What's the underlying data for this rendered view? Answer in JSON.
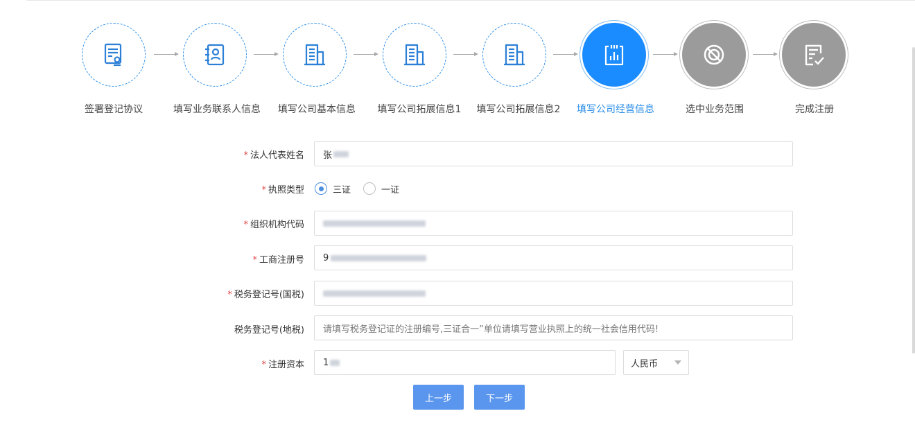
{
  "steps": [
    {
      "label": "签署登记协议",
      "icon": "sign-agreement-icon",
      "state": "done"
    },
    {
      "label": "填写业务联系人信息",
      "icon": "contacts-icon",
      "state": "done"
    },
    {
      "label": "填写公司基本信息",
      "icon": "building-icon",
      "state": "done"
    },
    {
      "label": "填写公司拓展信息1",
      "icon": "building-icon",
      "state": "done"
    },
    {
      "label": "填写公司拓展信息2",
      "icon": "building-icon",
      "state": "done"
    },
    {
      "label": "填写公司经营信息",
      "icon": "chart-board-icon",
      "state": "active"
    },
    {
      "label": "选中业务范围",
      "icon": "no-scope-icon",
      "state": "todo"
    },
    {
      "label": "完成注册",
      "icon": "checklist-icon",
      "state": "todo"
    }
  ],
  "colors": {
    "accent": "#1a8cff",
    "required": "#e14d4d",
    "button": "#5b96ee",
    "inactive": "#9b9b9b"
  },
  "form": {
    "legal_rep": {
      "label": "法人代表姓名",
      "value": "张"
    },
    "license_type": {
      "label": "执照类型",
      "options": [
        "三证",
        "一证"
      ],
      "selected": "三证"
    },
    "org_code": {
      "label": "组织机构代码"
    },
    "business_reg": {
      "label": "工商注册号",
      "value_prefix": "9"
    },
    "tax_national": {
      "label": "税务登记号(国税)"
    },
    "tax_local": {
      "label": "税务登记号(地税)",
      "placeholder": "请填写税务登记证的注册编号,三证合一”单位请填写营业执照上的统一社会信用代码!"
    },
    "capital": {
      "label": "注册资本",
      "value_prefix": "1",
      "currency": "人民币"
    }
  },
  "buttons": {
    "prev": "上一步",
    "next": "下一步"
  }
}
